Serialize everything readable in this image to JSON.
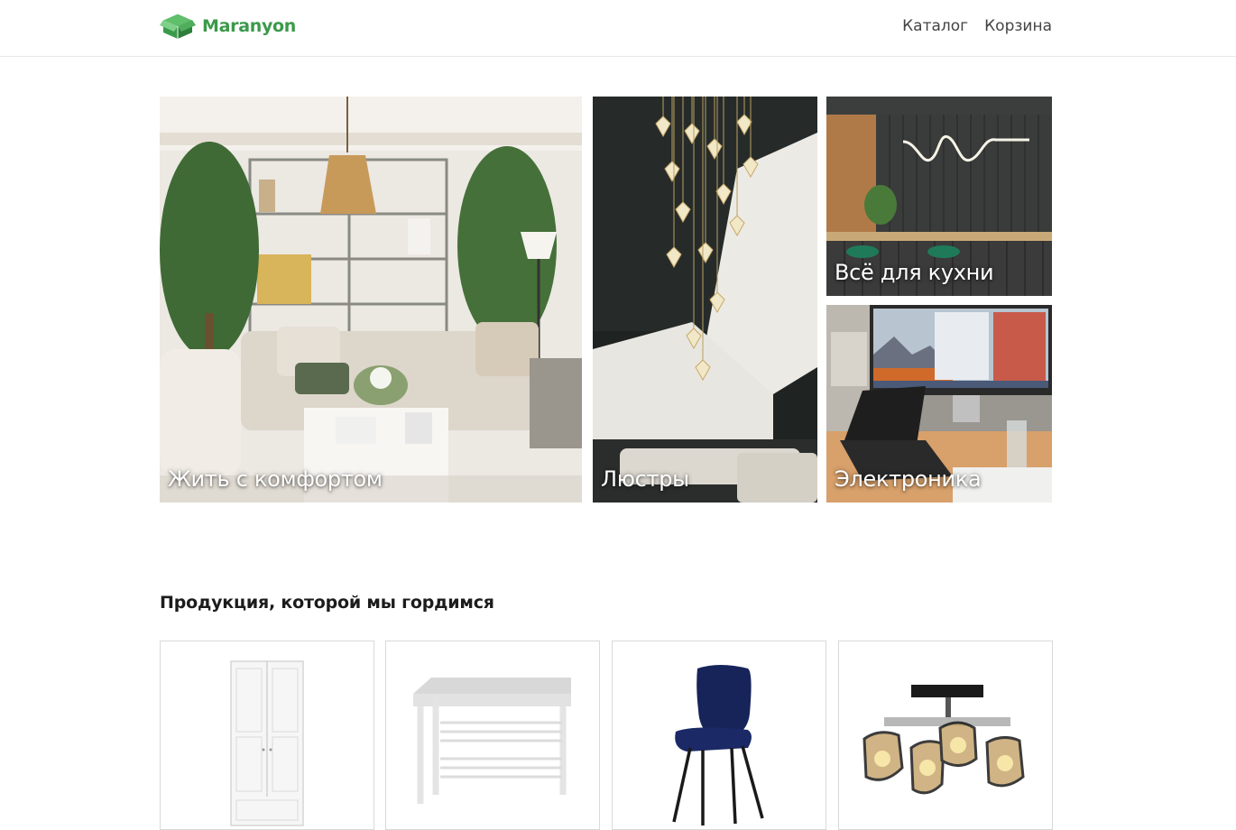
{
  "brand": {
    "name": "Maranyon",
    "accent_color": "#3a9a4a"
  },
  "nav": {
    "items": [
      {
        "label": "Каталог"
      },
      {
        "label": "Корзина"
      }
    ]
  },
  "hero": {
    "tiles": [
      {
        "label": "Жить с комфортом",
        "image": "living-room-photo"
      },
      {
        "label": "Люстры",
        "image": "chandelier-photo"
      },
      {
        "label": "Всё для кухни",
        "image": "kitchen-photo"
      },
      {
        "label": "Электроника",
        "image": "workspace-computer-photo"
      }
    ]
  },
  "products": {
    "title": "Продукция, которой мы гордимся",
    "items": [
      {
        "image": "white-wardrobe"
      },
      {
        "image": "shoe-bench"
      },
      {
        "image": "blue-velvet-chair"
      },
      {
        "image": "ceiling-lamp"
      }
    ]
  }
}
